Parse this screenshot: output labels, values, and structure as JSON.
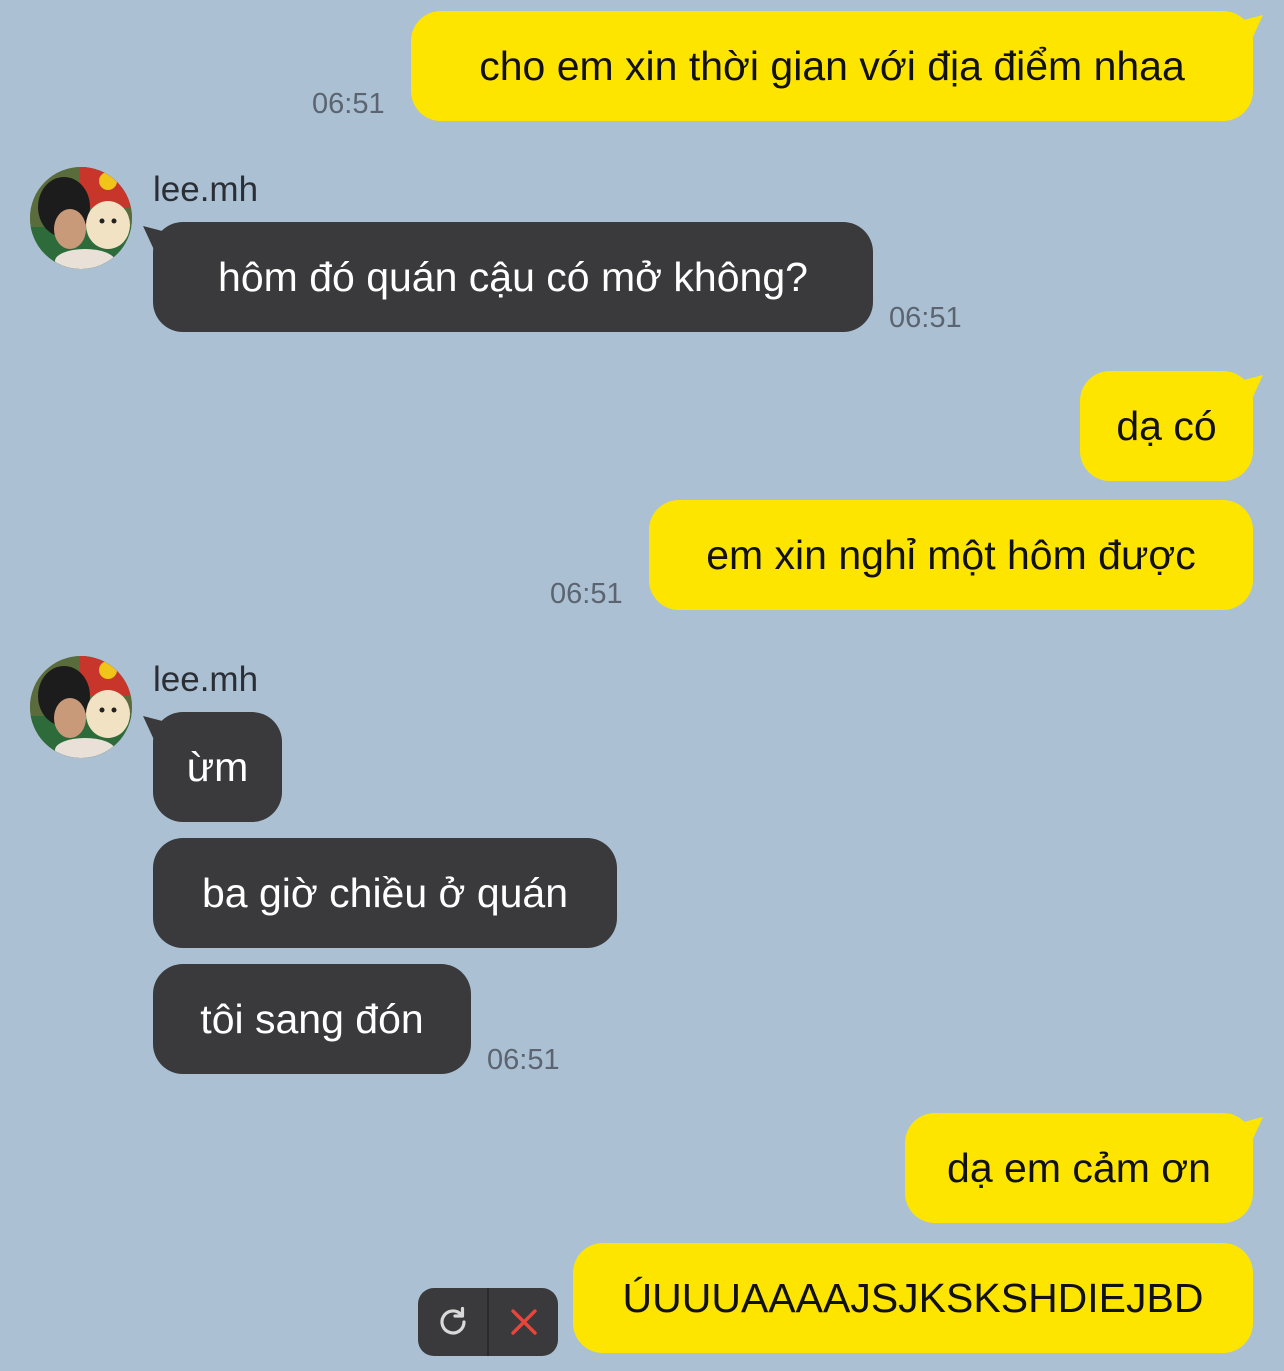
{
  "colors": {
    "background": "#abc1d3",
    "outgoing_bubble": "#fee500",
    "incoming_bubble": "#3a3a3c",
    "timestamp": "#5b6470",
    "cancel_x": "#e8453c"
  },
  "messages": {
    "m1": {
      "text": "cho em xin thời gian với địa điểm nhaa",
      "time": "06:51"
    },
    "g1": {
      "sender": "lee.mh",
      "m2": {
        "text": "hôm đó quán cậu có mở không?",
        "time": "06:51"
      }
    },
    "m3": {
      "text": "dạ có"
    },
    "m4": {
      "text": "em xin nghỉ một hôm được",
      "time": "06:51"
    },
    "g2": {
      "sender": "lee.mh",
      "m5": {
        "text": "ừm"
      },
      "m6": {
        "text": "ba giờ chiều ở quán"
      },
      "m7": {
        "text": "tôi sang đón",
        "time": "06:51"
      }
    },
    "m8": {
      "text": "dạ em cảm ơn"
    },
    "m9": {
      "text": "ÚUUUAAAAJSJKSKSHDIEJBD"
    }
  },
  "failed_actions": {
    "retry_icon": "refresh-icon",
    "cancel_icon": "close-icon"
  }
}
